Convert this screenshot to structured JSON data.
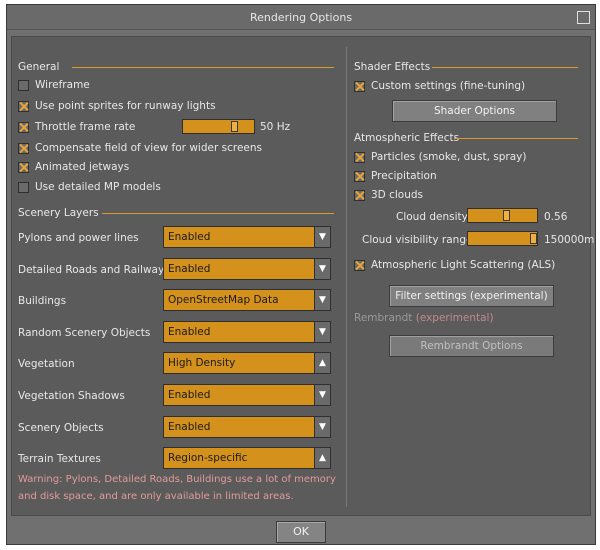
{
  "window": {
    "title": "Rendering Options"
  },
  "general": {
    "heading": "General",
    "options": [
      {
        "label": "Wireframe",
        "checked": false
      },
      {
        "label": "Use point sprites for runway lights",
        "checked": true
      },
      {
        "label": "Throttle frame rate",
        "checked": true
      },
      {
        "label": "Compensate field of view for wider screens",
        "checked": true
      },
      {
        "label": "Animated jetways",
        "checked": true
      },
      {
        "label": "Use detailed MP models",
        "checked": false
      }
    ],
    "frame_rate": {
      "value": "50 Hz",
      "level": 0.75
    }
  },
  "scenery": {
    "heading": "Scenery Layers",
    "layers": [
      {
        "label": "Pylons and power lines",
        "value": "Enabled",
        "arrow": "▼"
      },
      {
        "label": "Detailed Roads and Railways",
        "value": "Enabled",
        "arrow": "▼"
      },
      {
        "label": "Buildings",
        "value": "OpenStreetMap Data",
        "arrow": "▼"
      },
      {
        "label": "Random Scenery Objects",
        "value": "Enabled",
        "arrow": "▼"
      },
      {
        "label": "Vegetation",
        "value": "High Density",
        "arrow": "▲"
      },
      {
        "label": "Vegetation Shadows",
        "value": "Enabled",
        "arrow": "▼"
      },
      {
        "label": "Scenery Objects",
        "value": "Enabled",
        "arrow": "▼"
      },
      {
        "label": "Terrain Textures",
        "value": "Region-specific",
        "arrow": "▲"
      }
    ],
    "warning_line1": "Warning: Pylons, Detailed Roads, Buildings use a lot of memory",
    "warning_line2": "and disk space, and are only available in limited areas."
  },
  "shader": {
    "heading": "Shader Effects",
    "custom": {
      "label": "Custom settings (fine-tuning)",
      "checked": true
    },
    "button": "Shader Options"
  },
  "atmosphere": {
    "heading": "Atmospheric Effects",
    "options": [
      {
        "label": "Particles (smoke, dust, spray)",
        "checked": true
      },
      {
        "label": "Precipitation",
        "checked": true
      },
      {
        "label": "3D clouds",
        "checked": true
      }
    ],
    "cloud_density": {
      "label": "Cloud density",
      "value": "0.56",
      "level": 0.56
    },
    "cloud_visibility": {
      "label": "Cloud visibility range",
      "value": "150000m",
      "level": 1.0
    },
    "als": {
      "label": "Atmospheric Light Scattering (ALS)",
      "checked": true
    },
    "filter_button": "Filter settings (experimental)"
  },
  "rembrandt": {
    "label": "Rembrandt",
    "note": "(experimental)",
    "button": "Rembrandt Options"
  },
  "footer": {
    "ok": "OK"
  },
  "colors": {
    "accent": "#d4911c",
    "warning": "#e39b9b",
    "panel": "#5b5b5b"
  }
}
